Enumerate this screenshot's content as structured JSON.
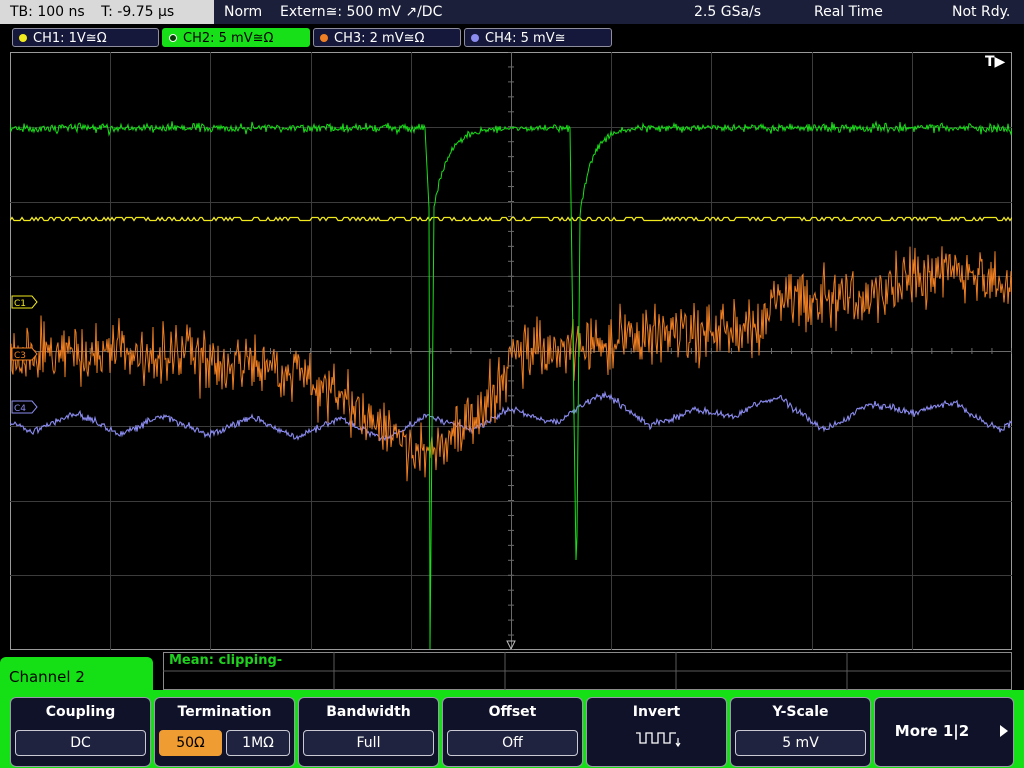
{
  "top_bar": {
    "timebase": "TB: 100 ns",
    "trigger_time": "T: -9.75 µs",
    "mode": "Norm",
    "trigger_source": "Extern≅: 500 mV ↗/DC",
    "sample_rate": "2.5 GSa/s",
    "acq_mode": "Real Time",
    "status": "Not Rdy."
  },
  "channels": [
    {
      "label": "CH1: 1V≅Ω",
      "color": "#f2ea1c"
    },
    {
      "label": "CH2: 5 mV≅Ω",
      "color": "#18e018"
    },
    {
      "label": "CH3: 2 mV≅Ω",
      "color": "#ef7f22"
    },
    {
      "label": "CH4: 5 mV≅",
      "color": "#8b8bf0"
    }
  ],
  "screen": {
    "trigger_marker": "T▶",
    "markers": {
      "c1": "C1",
      "c3": "C3",
      "c4": "C4"
    }
  },
  "measurement": {
    "label": "Mean: clipping-"
  },
  "menu": {
    "title": "Channel 2",
    "coupling": {
      "title": "Coupling",
      "value": "DC"
    },
    "termination": {
      "title": "Termination",
      "options": [
        "50Ω",
        "1MΩ"
      ],
      "selected": "50Ω"
    },
    "bandwidth": {
      "title": "Bandwidth",
      "value": "Full"
    },
    "offset": {
      "title": "Offset",
      "value": "Off"
    },
    "invert": {
      "title": "Invert"
    },
    "yscale": {
      "title": "Y-Scale",
      "value": "5 mV"
    },
    "more": {
      "title": "More 1|2"
    }
  },
  "icons": {
    "more_arrow": "triangle-right-icon",
    "invert": "square-wave-icon"
  }
}
